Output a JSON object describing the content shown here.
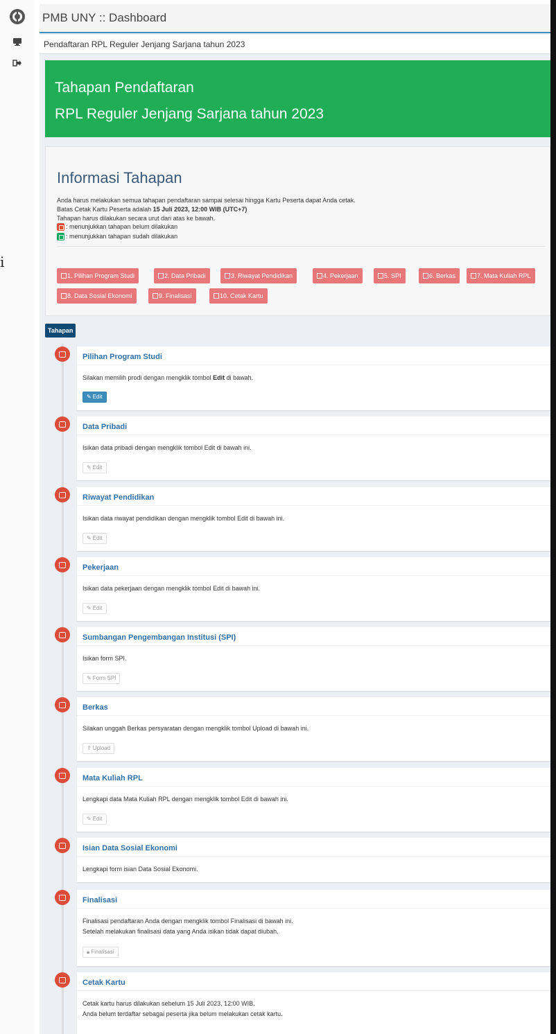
{
  "header": {
    "title": "PMB UNY :: Dashboard",
    "subtitle": "Pendaftaran RPL Reguler Jenjang Sarjana tahun 2023"
  },
  "stray_char": "i",
  "hero": {
    "line1": "Tahapan Pendaftaran",
    "line2": "RPL Reguler Jenjang Sarjana tahun 2023"
  },
  "info": {
    "title": "Informasi Tahapan",
    "line1": "Anda harus melakukan semua tahapan pendaftaran sampai selesai hingga Kartu Peserta dapat Anda cetak.",
    "line2_prefix": "Batas Cetak Kartu Peserta adalah ",
    "line2_bold": "15 Juli 2023, 12:00 WIB (UTC+7)",
    "line3": "Tahapan harus dilakukan secara urut dari atas ke bawah.",
    "legend_red": ": menunjukkan tahapan belum dilakukan",
    "legend_green": ": menunjukkan tahapan sudah dilakukan"
  },
  "pills": [
    "1. Pilihan Program Studi",
    "2. Data Pribadi",
    "3. Riwayat Pendidikan",
    "4. Pekerjaan",
    "5. SPI",
    "6. Berkas",
    "7. Mata Kuliah RPL",
    "8. Data Sosial Ekonomi",
    "9. Finalisasi",
    "10. Cetak Kartu"
  ],
  "timeline_label": "Tahapan",
  "steps": [
    {
      "title": "Pilihan Program Studi",
      "body_prefix": "Silakan memilih prodi dengan mengklik tombol ",
      "body_bold": "Edit",
      "body_suffix": " di bawah.",
      "button": "Edit"
    },
    {
      "title": "Data Pribadi",
      "body": "Isikan data pribadi dengan mengklik tombol Edit di bawah ini.",
      "button": "Edit"
    },
    {
      "title": "Riwayat Pendidikan",
      "body": "Isikan data riwayat pendidikan dengan mengklik tombol Edit di bawah ini.",
      "button": "Edit"
    },
    {
      "title": "Pekerjaan",
      "body": "Isikan data pekerjaan dengan mengklik tombol Edit di bawah ini.",
      "button": "Edit"
    },
    {
      "title": "Sumbangan Pengembangan Institusi (SPI)",
      "body": "Isikan form SPI.",
      "button": "Form SPI"
    },
    {
      "title": "Berkas",
      "body": "Silakan unggah Berkas persyaratan dengan mengklik tombol Upload di bawah ini.",
      "button": "Upload"
    },
    {
      "title": "Mata Kuliah RPL",
      "body": "Lengkapi data Mata Kuliah RPL dengan mengklik tombol Edit di bawah ini.",
      "button": "Edit"
    },
    {
      "title": "Isian Data Sosial Ekonomi",
      "body": "Lengkapi form isian Data Sosial Ekonomi."
    },
    {
      "title": "Finalisasi",
      "body": "Finalisasi pendaftaran Anda dengan mengklik tombol Finalisasi di bawah ini.",
      "body2": "Setelah melakukan finalisasi data yang Anda isikan tidak dapat diubah.",
      "button": "Finalisasi"
    },
    {
      "title": "Cetak Kartu",
      "body": "Cetak kartu harus dilakukan sebelum 15 Juli 2023, 12:00 WIB.",
      "body2": "Anda belum terdaftar sebagai peserta jika belum melakukan cetak kartu."
    }
  ],
  "colors": {
    "hero": "#1fae55",
    "pending": "#dd4b39",
    "done": "#00a65a",
    "pill": "#e8777a",
    "link": "#2f6fa8",
    "primary": "#3c8dbc"
  }
}
